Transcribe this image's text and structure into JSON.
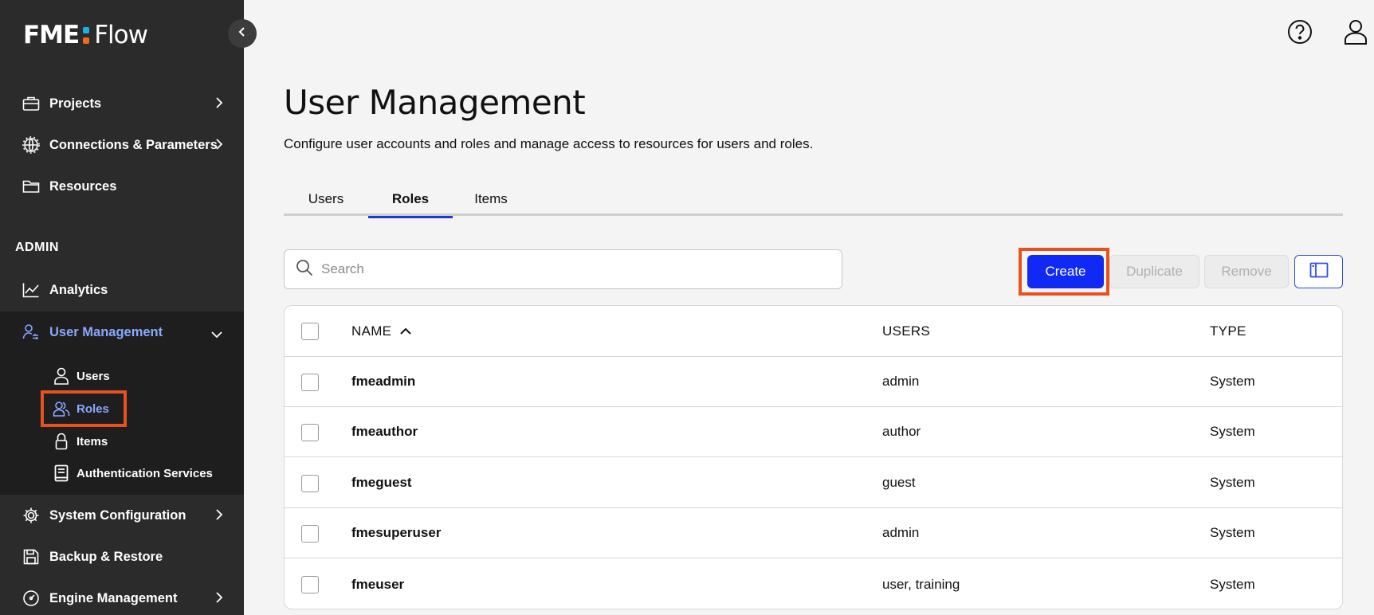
{
  "logo": {
    "left": "FME",
    "right": "Flow",
    "dot_colors": [
      "#1ab0e6",
      "#f06a22"
    ]
  },
  "sidebar": {
    "nav": [
      {
        "label": "Projects",
        "icon": "briefcase-icon"
      },
      {
        "label": "Connections & Parameters",
        "icon": "globe-gear-icon"
      },
      {
        "label": "Resources",
        "icon": "folder-icon"
      }
    ],
    "admin_label": "ADMIN",
    "admin_nav": {
      "analytics": "Analytics",
      "user_management": "User Management",
      "sub_items": {
        "users": "Users",
        "roles": "Roles",
        "items": "Items",
        "auth": "Authentication Services"
      },
      "system_configuration": "System Configuration",
      "backup_restore": "Backup & Restore",
      "engine_management": "Engine Management"
    }
  },
  "header": {
    "help_icon": "help-icon",
    "account_icon": "user-account-icon"
  },
  "main": {
    "title": "User Management",
    "description": "Configure user accounts and roles and manage access to resources for users and roles.",
    "tabs": [
      "Users",
      "Roles",
      "Items"
    ],
    "active_tab": "Roles",
    "search": {
      "placeholder": "Search",
      "value": ""
    },
    "buttons": {
      "create": "Create",
      "duplicate": "Duplicate",
      "remove": "Remove"
    }
  },
  "table": {
    "columns": [
      "NAME",
      "USERS",
      "TYPE"
    ],
    "rows": [
      {
        "name": "fmeadmin",
        "users": "admin",
        "type": "System"
      },
      {
        "name": "fmeauthor",
        "users": "author",
        "type": "System"
      },
      {
        "name": "fmeguest",
        "users": "guest",
        "type": "System"
      },
      {
        "name": "fmesuperuser",
        "users": "admin",
        "type": "System"
      },
      {
        "name": "fmeuser",
        "users": "user, training",
        "type": "System"
      }
    ]
  },
  "colors": {
    "accent": "#1029f5",
    "sidebar_bg": "#2b2b2b",
    "active_nav": "#8aa8ff",
    "highlight": "#e8511f"
  }
}
